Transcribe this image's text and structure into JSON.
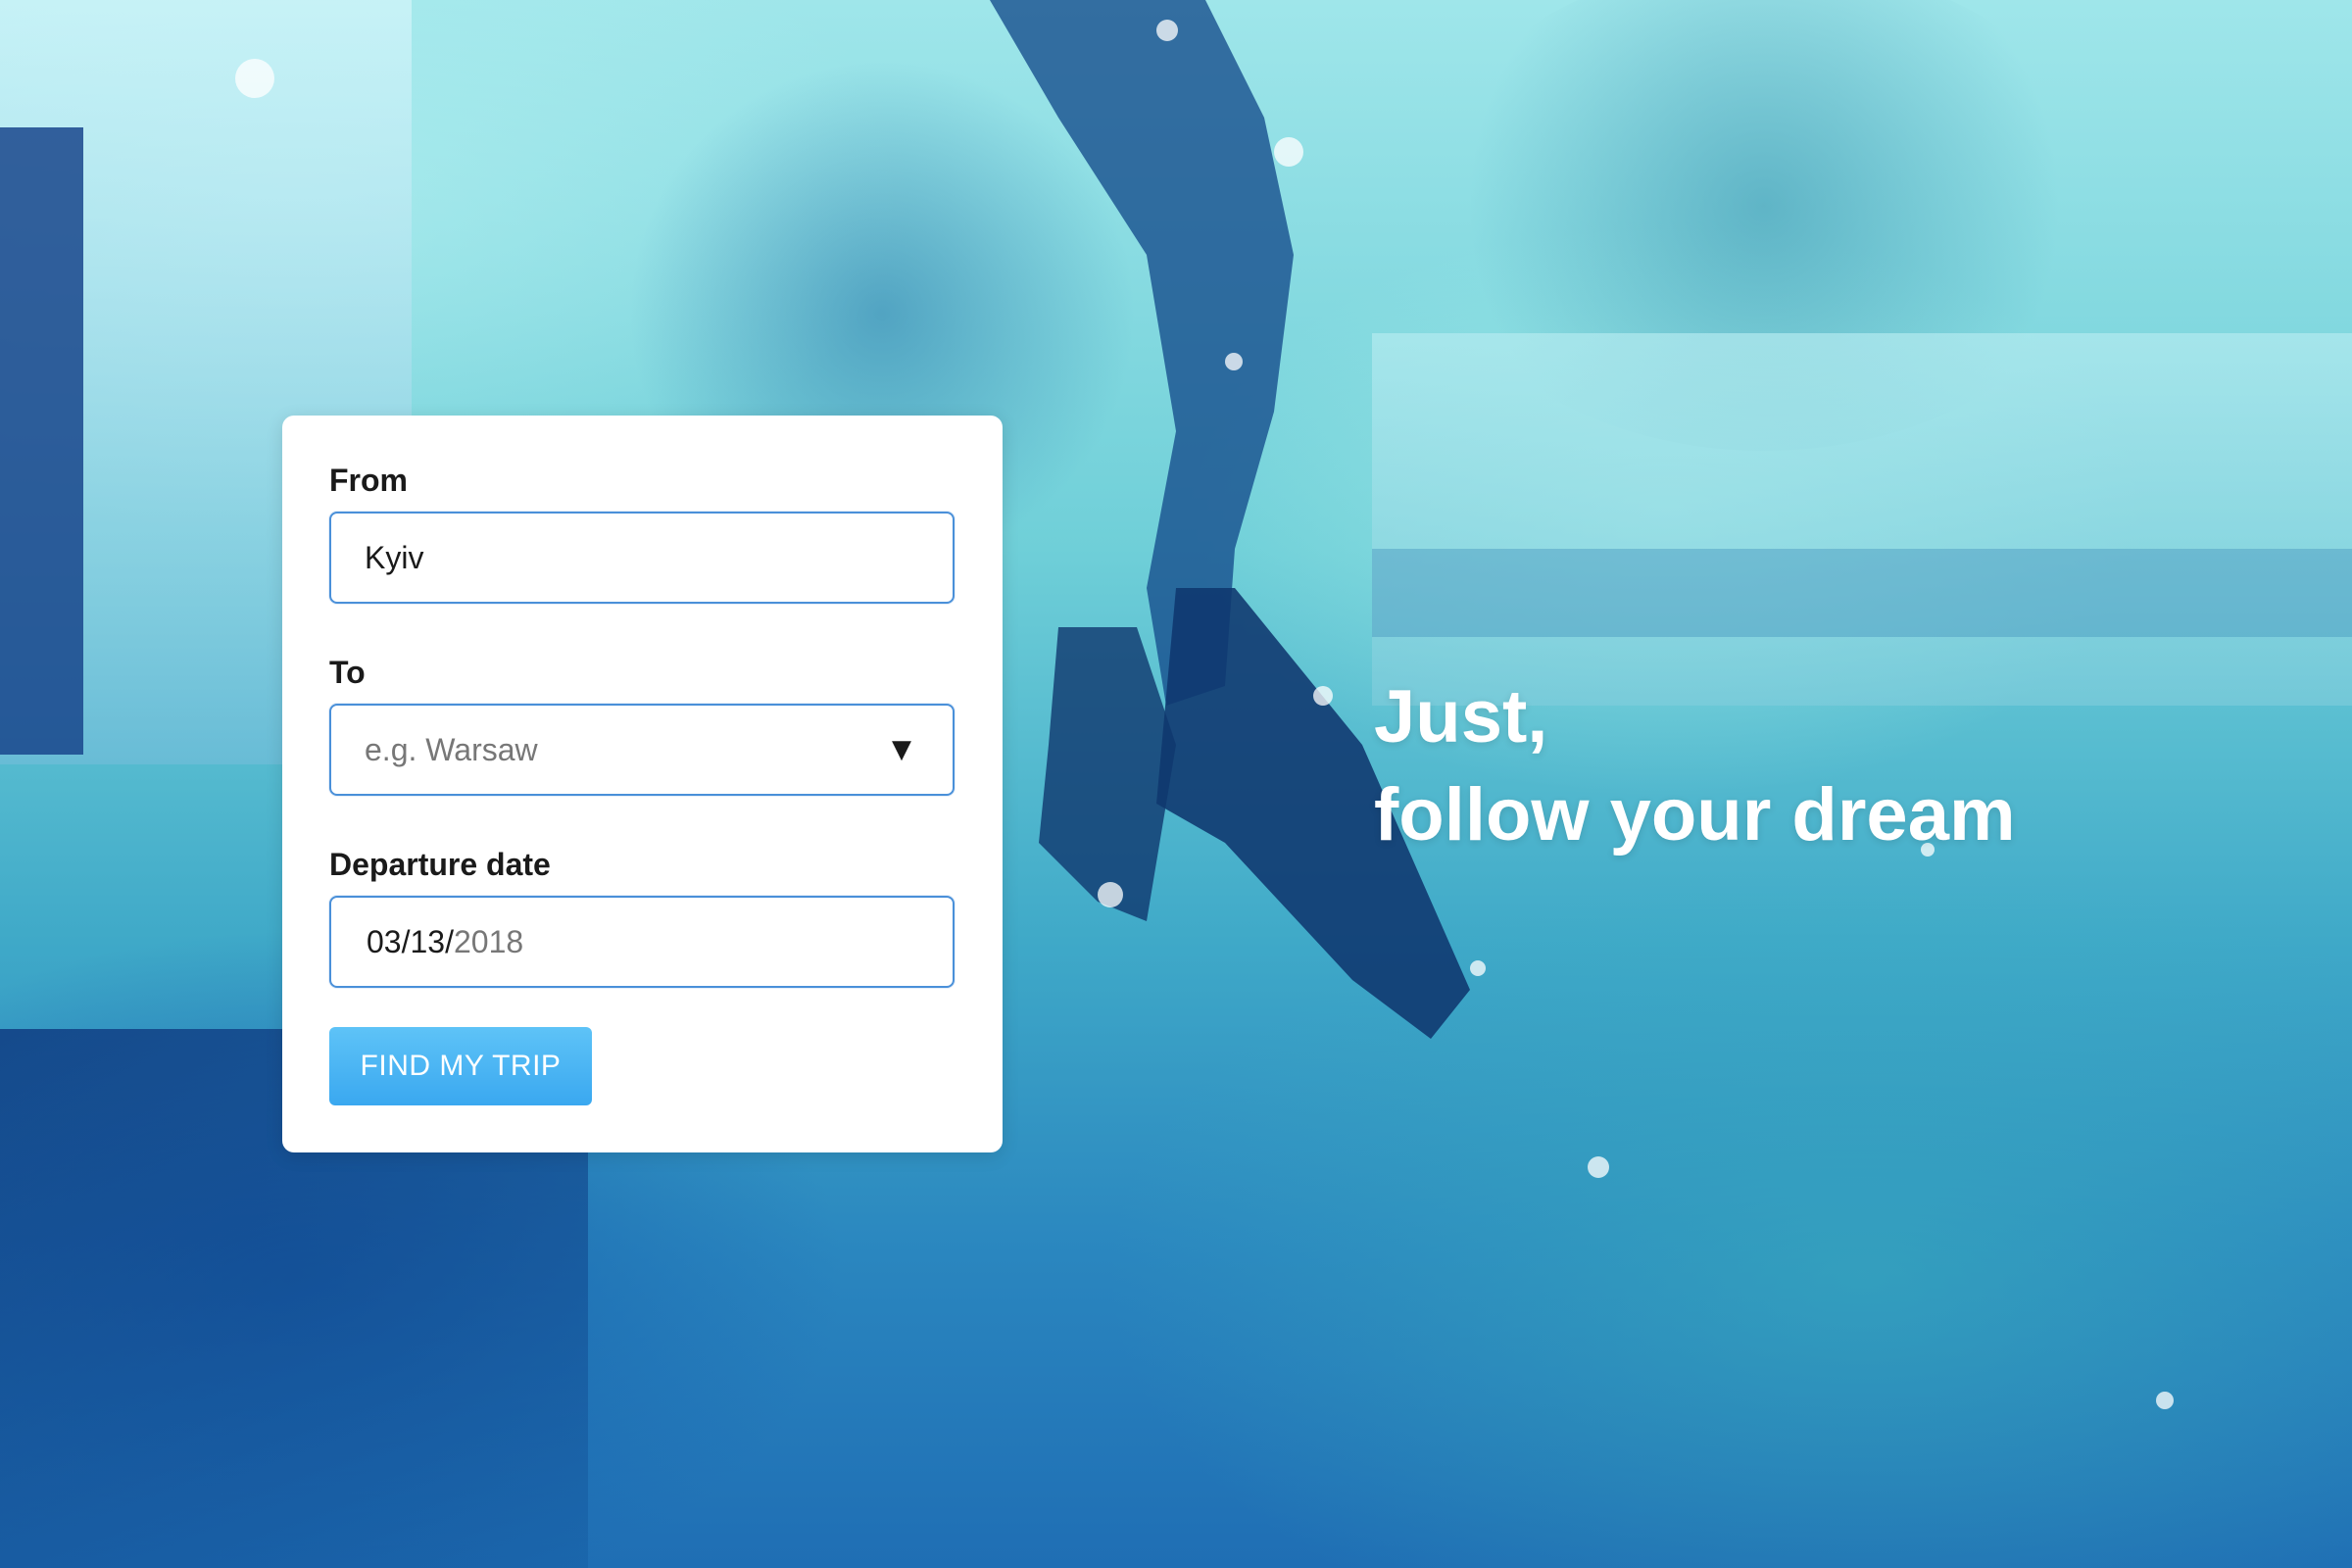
{
  "form": {
    "from": {
      "label": "From",
      "value": "Kyiv"
    },
    "to": {
      "label": "To",
      "placeholder": "e.g. Warsaw",
      "caret_icon": "triangle-down-icon",
      "caret_glyph": "▼"
    },
    "departure": {
      "label": "Departure date",
      "month_day": "03/13/",
      "year": "2018"
    },
    "submit_label": "FIND MY TRIP"
  },
  "hero": {
    "line1": "Just,",
    "line2": "follow your dream"
  },
  "colors": {
    "accent": "#3aa8f0",
    "field_border": "#4a90d9",
    "card_bg": "#ffffff",
    "overlay": "#3fa9c8"
  }
}
